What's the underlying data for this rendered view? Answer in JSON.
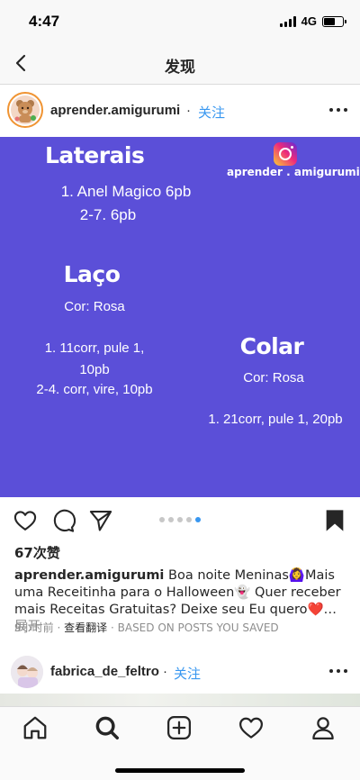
{
  "status_bar": {
    "time": "4:47",
    "network": "4G"
  },
  "nav": {
    "title": "发现",
    "back_icon": "chevron-left-icon"
  },
  "post": {
    "username": "aprender.amigurumi",
    "separator": "·",
    "follow_label": "关注",
    "image": {
      "brand_handle": "aprender . amigurumi",
      "laterais": {
        "title": "Laterais",
        "line1": "1. Anel Magico 6pb",
        "line2": "2-7. 6pb"
      },
      "laco": {
        "title": "Laço",
        "color": "Cor: Rosa",
        "line1": "1. 11corr, pule 1,",
        "line2": "10pb",
        "line3": "2-4. corr, vire, 10pb"
      },
      "colar": {
        "title": "Colar",
        "color": "Cor: Rosa",
        "line1": "1. 21corr, pule 1, 20pb"
      }
    },
    "carousel": {
      "total": 5,
      "active_index": 4
    },
    "likes": "67次赞",
    "caption": {
      "username": "aprender.amigurumi",
      "text": " Boa noite Meninas🙆‍♀️Mais uma Receitinha para o Halloween👻 Quer receber mais Receitas Gratuitas? Deixe seu Eu quero❤️… ",
      "more_label": "展开"
    },
    "time_ago": "9小时前",
    "translate_label": "查看翻译",
    "based_on": "BASED ON POSTS YOU SAVED"
  },
  "next_post": {
    "username": "fabrica_de_feltro",
    "separator": "·",
    "follow_label": "关注"
  },
  "tab_bar": {
    "items": [
      "home-icon",
      "search-icon",
      "new-post-icon",
      "activity-heart-icon",
      "profile-icon"
    ]
  },
  "colors": {
    "image_bg": "#5b4fd8",
    "follow_blue": "#3897f0",
    "meta_gray": "#8e8e8e"
  }
}
